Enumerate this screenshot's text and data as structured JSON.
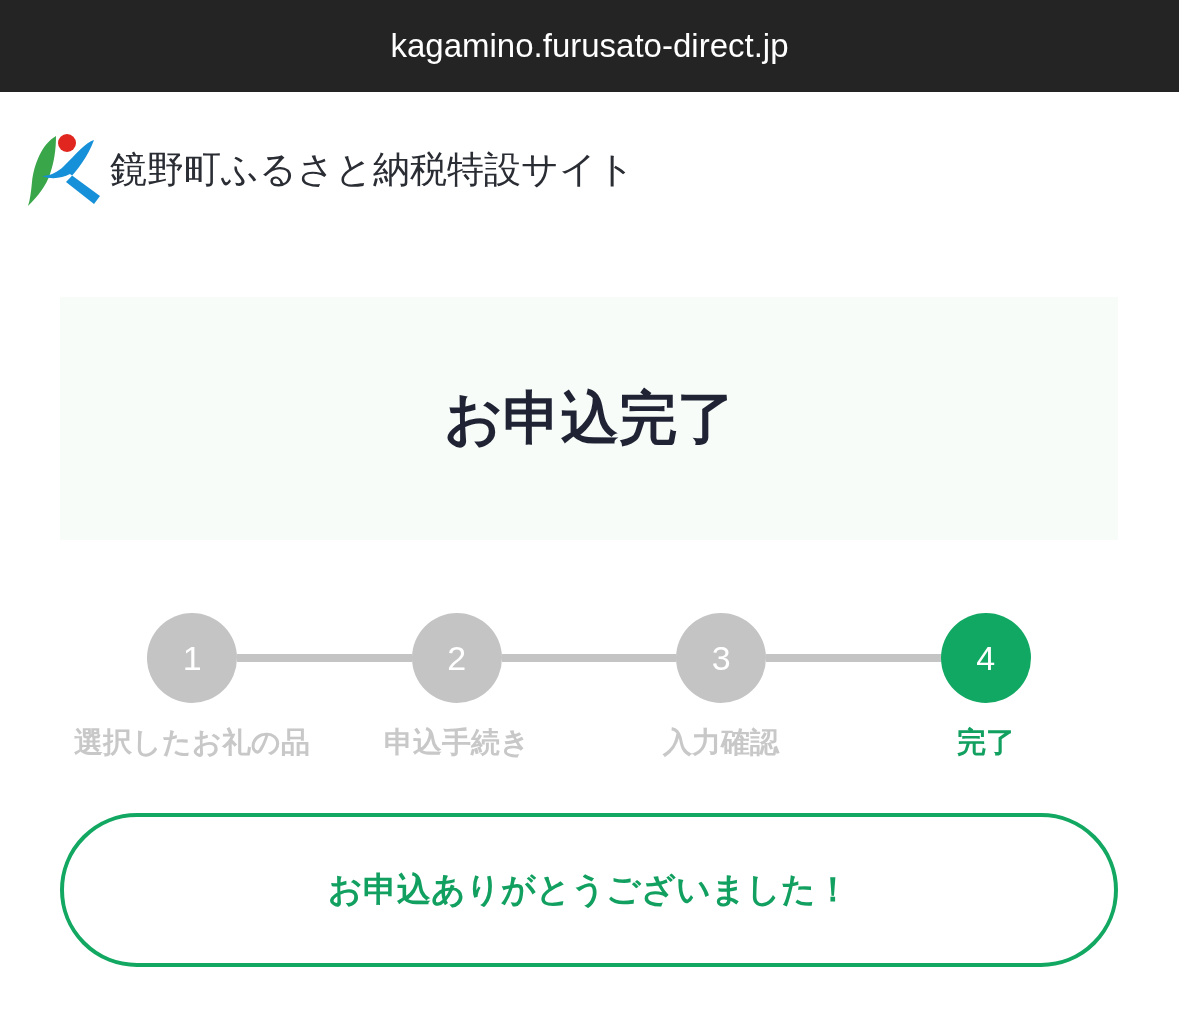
{
  "browser_bar": {
    "url": "kagamino.furusato-direct.jp"
  },
  "header": {
    "site_title": "鏡野町ふるさと納税特設サイト"
  },
  "hero": {
    "title": "お申込完了"
  },
  "steps": [
    {
      "number": "1",
      "label": "選択したお礼の品",
      "selected": false
    },
    {
      "number": "2",
      "label": "申込手続き",
      "selected": false
    },
    {
      "number": "3",
      "label": "入力確認",
      "selected": false
    },
    {
      "number": "4",
      "label": "完了",
      "selected": true
    }
  ],
  "message": {
    "text": "お申込ありがとうございました！"
  }
}
